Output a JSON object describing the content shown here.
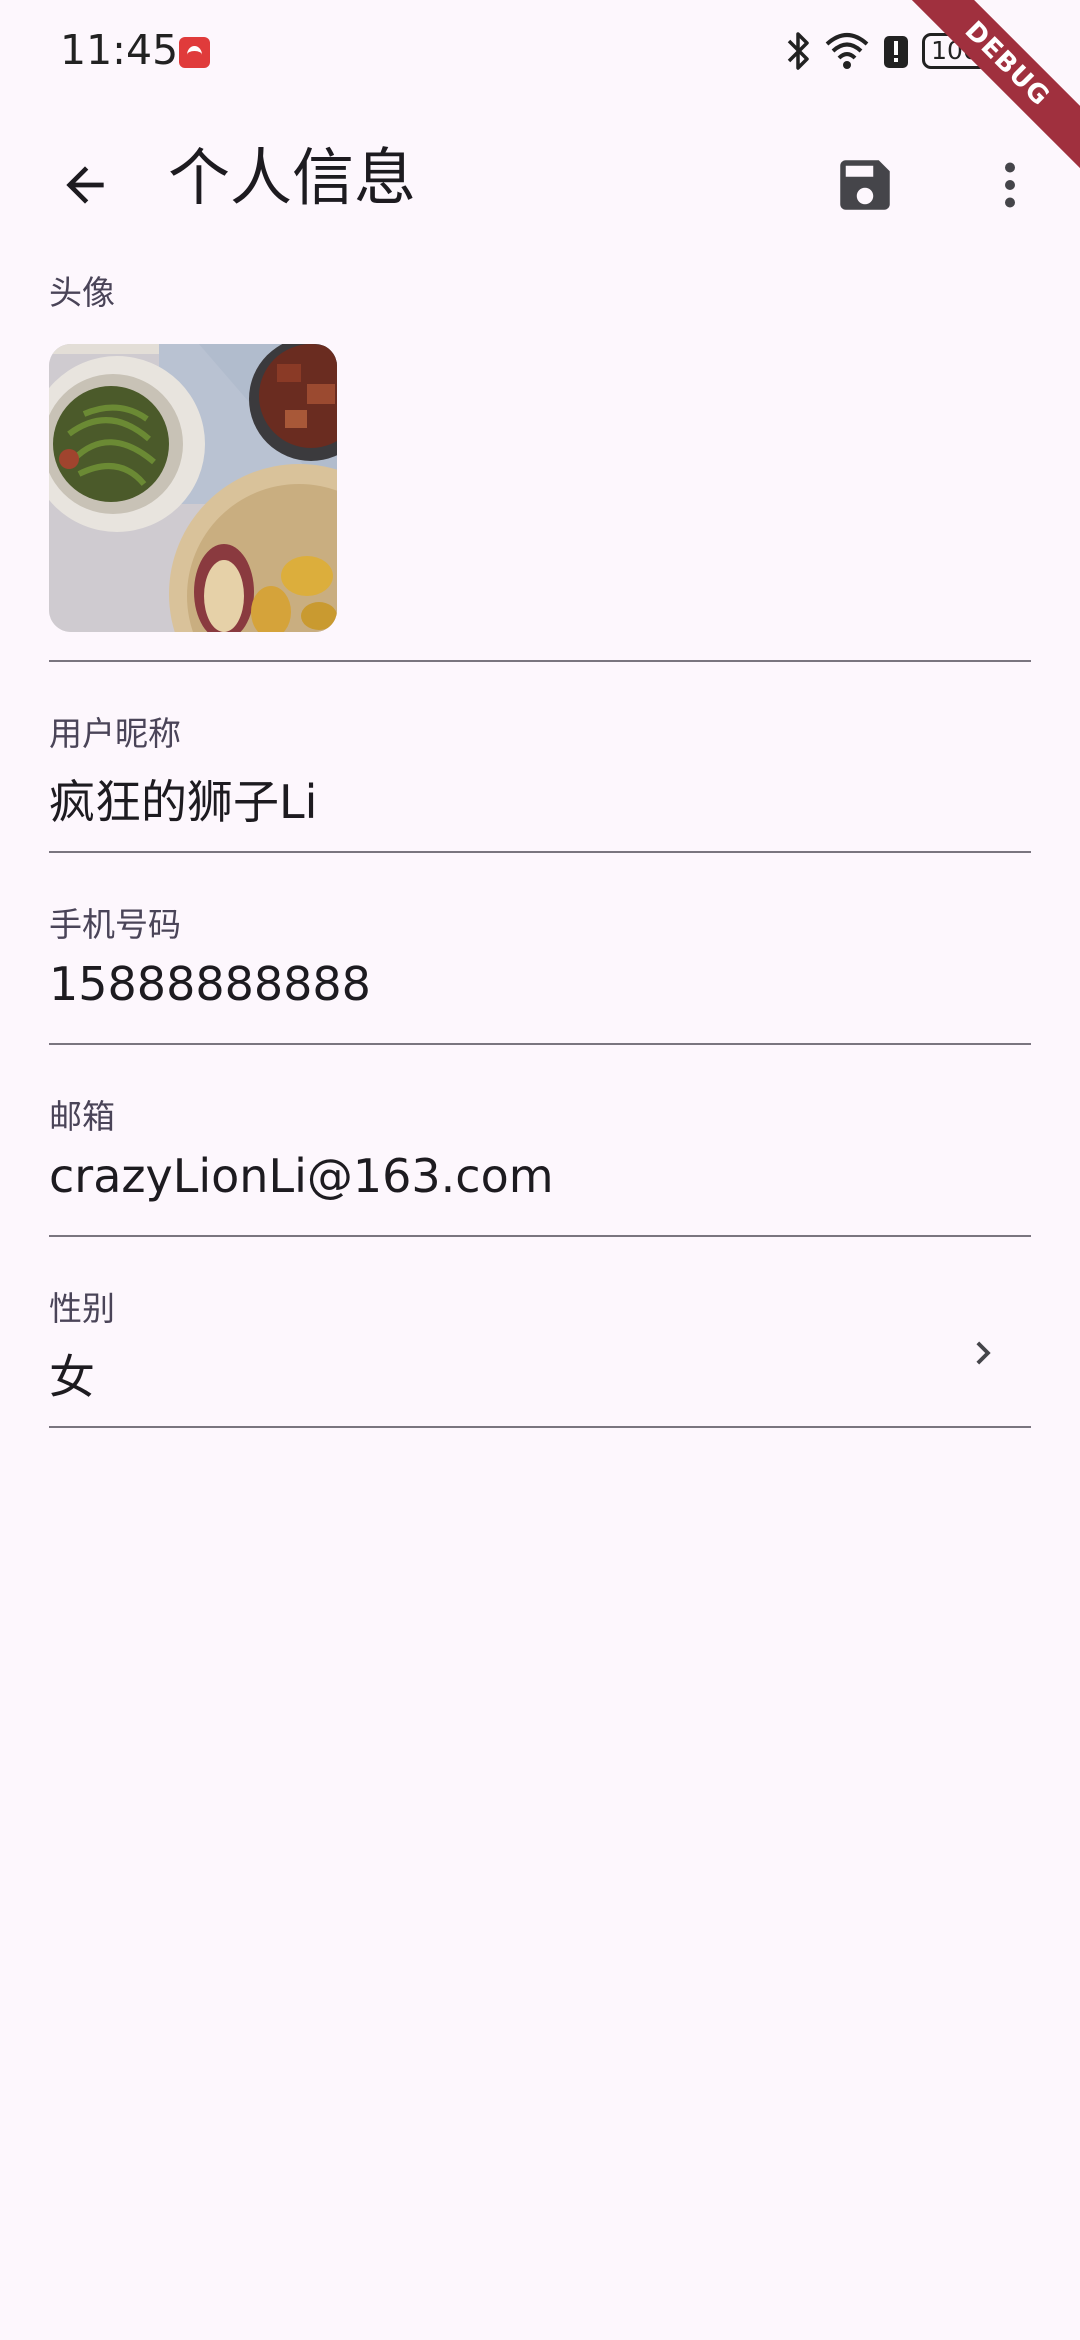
{
  "status_bar": {
    "time": "11:45",
    "battery": "100",
    "icons": [
      "bluetooth-icon",
      "wifi-icon",
      "alert-icon",
      "battery-icon",
      "charging-icon"
    ]
  },
  "debug_banner": "DEBUG",
  "app_bar": {
    "title": "个人信息",
    "back_icon": "arrow-back-icon",
    "save_icon": "save-icon",
    "more_icon": "more-vert-icon"
  },
  "form": {
    "avatar_label": "头像",
    "nickname": {
      "label": "用户昵称",
      "value": "疯狂的狮子Li"
    },
    "phone": {
      "label": "手机号码",
      "value": "15888888888"
    },
    "email": {
      "label": "邮箱",
      "value": "crazyLionLi@163.com"
    },
    "gender": {
      "label": "性别",
      "value": "女"
    }
  },
  "colors": {
    "background": "#fdf7fd",
    "text": "#1d1b20",
    "label": "#4a4458",
    "divider": "#7a757f",
    "debug_ribbon": "#a0303e"
  }
}
